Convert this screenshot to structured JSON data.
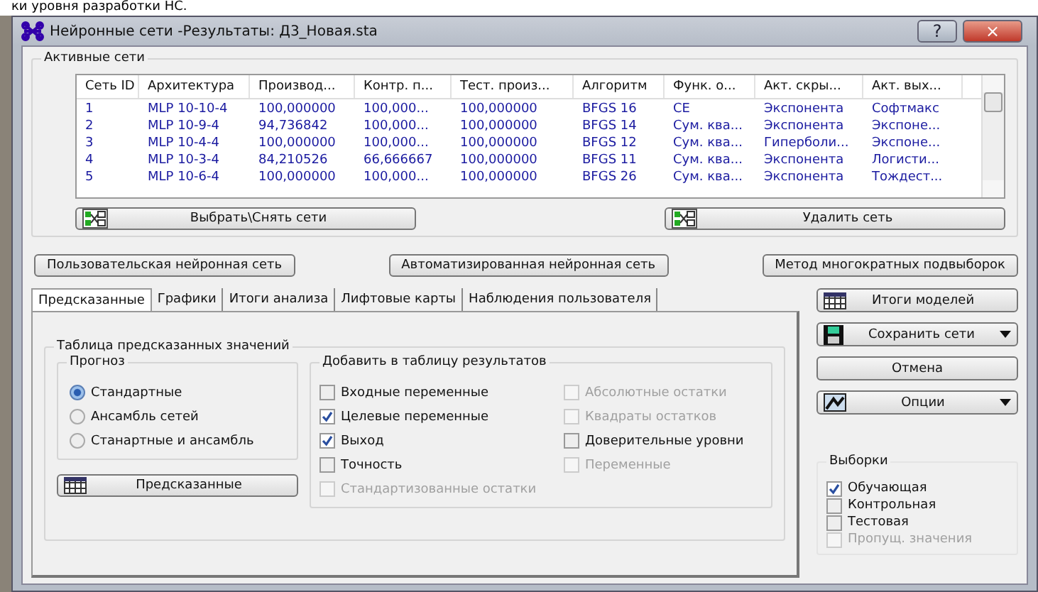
{
  "document_text": "ки уровня разработки НС.",
  "window": {
    "title": "Нейронные сети -Результаты: Д3_Новая.sta",
    "help": "?",
    "close": "×"
  },
  "active_networks": {
    "title": "Активные сети",
    "columns": [
      "Сеть ID",
      "Архитектура",
      "Производ...",
      "Контр. п...",
      "Тест. произ...",
      "Алгоритм",
      "Функ. о...",
      "Акт. скры...",
      "Акт. вых..."
    ],
    "rows": [
      [
        "1",
        "MLP 10-10-4",
        "100,000000",
        "100,000...",
        "100,000000",
        "BFGS 16",
        "CE",
        "Экспонента",
        "Софтмакс"
      ],
      [
        "2",
        "MLP 10-9-4",
        "94,736842",
        "100,000...",
        "100,000000",
        "BFGS 14",
        "Сум. ква...",
        "Экспонента",
        "Экспоне..."
      ],
      [
        "3",
        "MLP 10-4-4",
        "100,000000",
        "100,000...",
        "100,000000",
        "BFGS 12",
        "Сум. ква...",
        "Гиперболи...",
        "Экспоне..."
      ],
      [
        "4",
        "MLP 10-3-4",
        "84,210526",
        "66,666667",
        "100,000000",
        "BFGS 11",
        "Сум. ква...",
        "Экспонента",
        "Логисти..."
      ],
      [
        "5",
        "MLP 10-6-4",
        "100,000000",
        "100,000...",
        "100,000000",
        "BFGS 26",
        "Сум. ква...",
        "Экспонента",
        "Тождест..."
      ]
    ],
    "buttons": [
      "Выбрать\\Снять сети",
      "Удалить сеть"
    ]
  },
  "mode_buttons": [
    "Пользовательская нейронная сеть",
    "Автоматизированная нейронная сеть",
    "Метод многократных подвыборок"
  ],
  "tabs": [
    {
      "label": "Предсказанные",
      "selected": true
    },
    {
      "label": "Графики",
      "selected": false
    },
    {
      "label": "Итоги анализа",
      "selected": false
    },
    {
      "label": "Лифтовые карты",
      "selected": false
    },
    {
      "label": "Наблюдения пользователя",
      "selected": false
    }
  ],
  "predicted_table": {
    "title": "Таблица предсказанных значений",
    "forecast": {
      "title": "Прогноз",
      "options": [
        {
          "label": "Стандартные",
          "selected": true
        },
        {
          "label": "Ансамбль сетей",
          "selected": false
        },
        {
          "label": "Станартные и ансамбль",
          "selected": false
        }
      ]
    },
    "button": "Предсказанные",
    "add_to_results": {
      "title": "Добавить в таблицу результатов",
      "left": [
        {
          "label": "Входные переменные",
          "checked": false,
          "disabled": false
        },
        {
          "label": "Целевые переменные",
          "checked": true,
          "disabled": false
        },
        {
          "label": "Выход",
          "checked": true,
          "disabled": false
        },
        {
          "label": "Точность",
          "checked": false,
          "disabled": false
        },
        {
          "label": "Стандартизованные остатки",
          "checked": false,
          "disabled": true
        }
      ],
      "right": [
        {
          "label": "Абсолютные остатки",
          "checked": false,
          "disabled": true
        },
        {
          "label": "Квадраты остатков",
          "checked": false,
          "disabled": true
        },
        {
          "label": "Доверительные уровни",
          "checked": false,
          "disabled": false
        },
        {
          "label": "Переменные",
          "checked": false,
          "disabled": true
        }
      ]
    }
  },
  "side_buttons": [
    {
      "label": "Итоги моделей",
      "kind": "grid",
      "dropdown": false
    },
    {
      "label": "Сохранить сети",
      "kind": "disk",
      "dropdown": true
    },
    {
      "label": "Отмена",
      "kind": "plain",
      "dropdown": false
    },
    {
      "label": "Опции",
      "kind": "options",
      "dropdown": true
    }
  ],
  "samples": {
    "title": "Выборки",
    "items": [
      {
        "label": "Обучающая",
        "checked": true,
        "disabled": false
      },
      {
        "label": "Контрольная",
        "checked": false,
        "disabled": false
      },
      {
        "label": "Тестовая",
        "checked": false,
        "disabled": false
      },
      {
        "label": "Пропущ. значения",
        "checked": false,
        "disabled": true
      }
    ]
  }
}
